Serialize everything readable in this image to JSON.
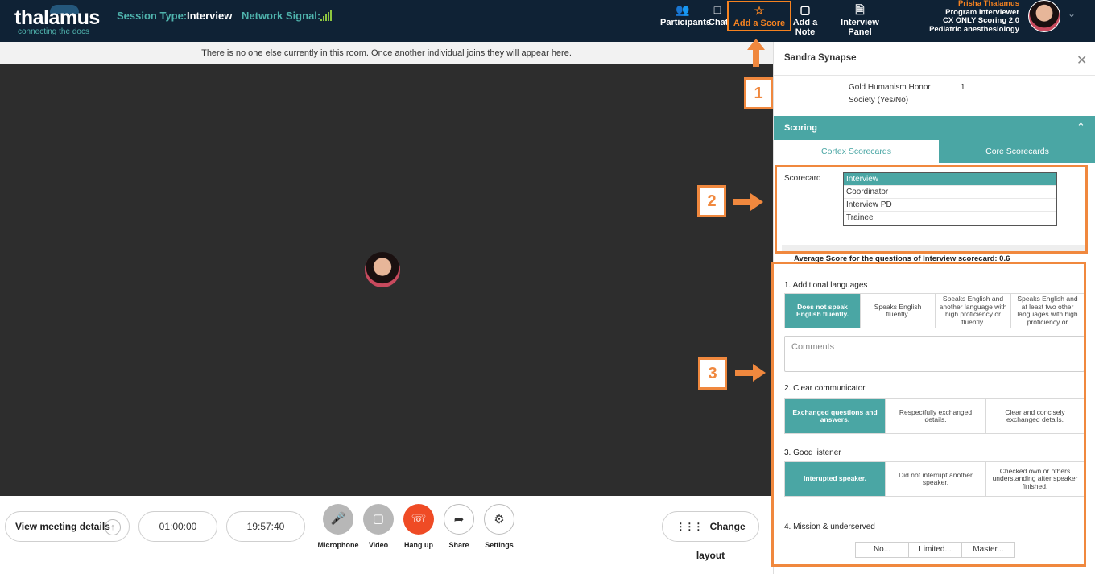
{
  "brand": {
    "name": "thalamus",
    "tagline": "connecting the docs"
  },
  "session": {
    "type_label": "Session Type:",
    "type_value": "Interview",
    "signal_label": "Network Signal:"
  },
  "toolbar": {
    "participants": "Participants",
    "chat": "Chat",
    "add_score": "Add a Score",
    "add_note": "Add a Note",
    "interview_panel": "Interview Panel"
  },
  "user": {
    "name": "Prisha Thalamus",
    "role": "Program Interviewer",
    "program": "CX ONLY Scoring 2.0",
    "specialty": "Pediatric anesthesiology"
  },
  "notice": "There is no one else currently in this room. Once another individual joins they will appear here.",
  "bottom": {
    "view_details": "View meeting details",
    "timer1": "01:00:00",
    "timer2": "19:57:40",
    "microphone": "Microphone",
    "video": "Video",
    "hangup": "Hang up",
    "share": "Share",
    "settings": "Settings",
    "change_layout": "Change layout"
  },
  "panel": {
    "title": "Sandra Synapse",
    "info_partial_label": "ACRT-Yes/No",
    "info_partial_value": "Yes",
    "info_label_1": "Gold Humanism Honor",
    "info_label_2": "Society (Yes/No)",
    "info_value": "1",
    "scoring_title": "Scoring",
    "tabs": {
      "cortex": "Cortex Scorecards",
      "core": "Core Scorecards"
    },
    "scorecard_label": "Scorecard",
    "scorecards": [
      "Interview",
      "Coordinator",
      "Interview PD",
      "Trainee"
    ],
    "average": "Average Score for the questions of Interview scorecard:  0.6",
    "comments_placeholder": "Comments",
    "questions": [
      {
        "title": "1. Additional languages",
        "options": [
          "Does not speak English fluently.",
          "Speaks English fluently.",
          "Speaks English and another language with high proficiency or fluently.",
          "Speaks English and at least two other languages with high proficiency or"
        ]
      },
      {
        "title": "2. Clear communicator",
        "options": [
          "Exchanged questions and answers.",
          "Respectfully exchanged details.",
          "Clear and concisely exchanged details."
        ]
      },
      {
        "title": "3. Good listener",
        "options": [
          "Interupted speaker.",
          "Did not interrupt another speaker.",
          "Checked own or others understanding after speaker finished."
        ]
      },
      {
        "title": "4. Mission & underserved",
        "options": [
          "No...",
          "Limited...",
          "Master..."
        ]
      }
    ]
  },
  "annotations": [
    "1",
    "2",
    "3"
  ],
  "colors": {
    "accent": "#4aa6a4",
    "highlight": "#f58220",
    "navbar": "#0f2235",
    "hangup": "#ef4b25"
  }
}
